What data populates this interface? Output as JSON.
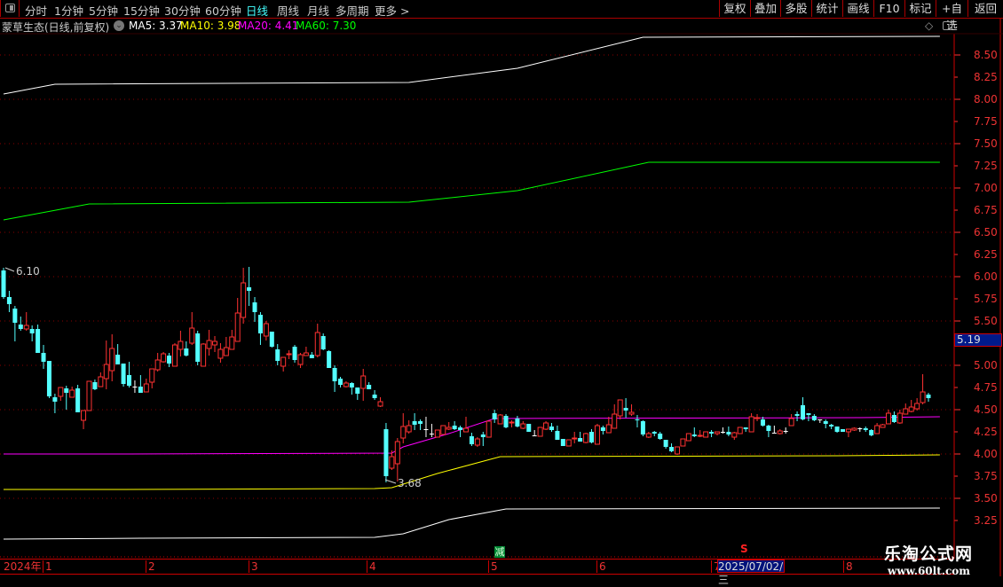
{
  "toolbar": {
    "tabs": [
      "分时",
      "1分钟",
      "5分钟",
      "15分钟",
      "30分钟",
      "60分钟",
      "日线",
      "周线",
      "月线",
      "多周期",
      "更多 >"
    ],
    "active_tab": "日线",
    "buttons": [
      "复权",
      "叠加",
      "多股",
      "统计",
      "画线",
      "F10",
      "标记",
      "+自选",
      "返回"
    ]
  },
  "info": {
    "title": "蒙草生态(日线,前复权)",
    "ma5": "MA5: 3.37",
    "ma10": "MA10: 3.98",
    "ma20": "MA20: 4.41",
    "ma60": "MA60: 7.30",
    "diamond": "◇"
  },
  "colors": {
    "up": "#ff3232",
    "down": "#54ffff",
    "flat": "#ffffff",
    "ma5": "#ffffff",
    "ma10": "#ffff00",
    "ma20": "#ff00ff",
    "ma60": "#00ff00",
    "axis": "#ff3333",
    "grid": "#8a0000"
  },
  "timeline": {
    "year": "2024年",
    "months": [
      "1",
      "2",
      "3",
      "4",
      "5",
      "6",
      "7",
      "8"
    ],
    "cursor_date": "2025/07/02/三"
  },
  "markers": {
    "jian": "减",
    "s": "S"
  },
  "price_tag": "5.19",
  "annotations": {
    "high": "6.10",
    "low": "3.68"
  },
  "watermark": {
    "name": "乐淘公式网",
    "url": "www.60lt.com"
  },
  "chart_data": {
    "type": "candlestick",
    "title": "蒙草生态(日线,前复权)",
    "ylim": [
      3.1,
      8.8
    ],
    "y_ticks": [
      "8.50",
      "8.25",
      "8.00",
      "7.75",
      "7.50",
      "7.25",
      "7.00",
      "6.75",
      "6.50",
      "6.25",
      "6.00",
      "5.75",
      "5.50",
      "5.25",
      "5.00",
      "4.75",
      "4.50",
      "4.25",
      "4.00",
      "3.75",
      "3.50",
      "3.25"
    ],
    "candles_ohlc": [
      [
        6.07,
        6.1,
        5.75,
        5.77
      ],
      [
        5.77,
        5.84,
        5.6,
        5.69
      ],
      [
        5.64,
        5.67,
        5.27,
        5.48
      ],
      [
        5.46,
        5.55,
        5.39,
        5.41
      ],
      [
        5.41,
        5.6,
        5.39,
        5.45
      ],
      [
        5.41,
        5.45,
        5.27,
        5.36
      ],
      [
        5.41,
        5.46,
        5.14,
        5.14
      ],
      [
        5.14,
        5.23,
        4.96,
        5.04
      ],
      [
        5.05,
        5.05,
        4.63,
        4.65
      ],
      [
        4.64,
        4.68,
        4.46,
        4.59
      ],
      [
        4.65,
        4.75,
        4.6,
        4.75
      ],
      [
        4.74,
        4.77,
        4.5,
        4.69
      ],
      [
        4.64,
        4.76,
        4.64,
        4.72
      ],
      [
        4.74,
        4.78,
        4.47,
        4.47
      ],
      [
        4.38,
        4.49,
        4.28,
        4.49
      ],
      [
        4.49,
        4.82,
        4.49,
        4.82
      ],
      [
        4.81,
        4.84,
        4.72,
        4.73
      ],
      [
        4.76,
        4.92,
        4.76,
        4.87
      ],
      [
        4.85,
        5.28,
        4.73,
        5.01
      ],
      [
        4.94,
        5.35,
        4.82,
        5.19
      ],
      [
        5.12,
        5.24,
        5.01,
        5.01
      ],
      [
        5.02,
        5.02,
        4.76,
        4.79
      ],
      [
        4.89,
        5.04,
        4.75,
        4.77
      ],
      [
        4.76,
        4.83,
        4.69,
        4.76
      ],
      [
        4.76,
        4.89,
        4.69,
        4.69
      ],
      [
        4.7,
        4.85,
        4.7,
        4.79
      ],
      [
        4.81,
        4.96,
        4.74,
        4.96
      ],
      [
        4.95,
        5.14,
        4.93,
        5.06
      ],
      [
        5.04,
        5.15,
        5.03,
        5.13
      ],
      [
        5.11,
        5.14,
        4.98,
        5.02
      ],
      [
        4.99,
        5.25,
        4.99,
        5.23
      ],
      [
        5.18,
        5.39,
        5.1,
        5.27
      ],
      [
        5.19,
        5.27,
        5.1,
        5.11
      ],
      [
        5.25,
        5.6,
        5.23,
        5.42
      ],
      [
        5.36,
        5.39,
        5.0,
        5.04
      ],
      [
        4.99,
        5.25,
        4.99,
        5.24
      ],
      [
        5.19,
        5.4,
        5.11,
        5.28
      ],
      [
        5.23,
        5.33,
        5.15,
        5.27
      ],
      [
        5.08,
        5.25,
        5.03,
        5.18
      ],
      [
        5.11,
        5.32,
        5.11,
        5.2
      ],
      [
        5.18,
        5.4,
        5.18,
        5.32
      ],
      [
        5.27,
        5.76,
        5.27,
        5.59
      ],
      [
        5.54,
        6.1,
        5.47,
        5.93
      ],
      [
        5.88,
        6.11,
        5.67,
        5.84
      ],
      [
        5.71,
        5.77,
        5.49,
        5.6
      ],
      [
        5.57,
        5.6,
        5.23,
        5.36
      ],
      [
        5.33,
        5.5,
        5.28,
        5.47
      ],
      [
        5.38,
        5.38,
        5.2,
        5.21
      ],
      [
        5.18,
        5.24,
        5.0,
        5.05
      ],
      [
        4.99,
        5.09,
        4.93,
        5.09
      ],
      [
        5.12,
        5.17,
        5.07,
        5.13
      ],
      [
        5.21,
        5.23,
        5.03,
        5.06
      ],
      [
        5.01,
        5.14,
        4.97,
        5.12
      ],
      [
        5.11,
        5.21,
        5.11,
        5.14
      ],
      [
        5.12,
        5.15,
        5.08,
        5.08
      ],
      [
        5.11,
        5.47,
        5.09,
        5.37
      ],
      [
        5.33,
        5.36,
        5.17,
        5.18
      ],
      [
        5.16,
        5.17,
        4.97,
        4.97
      ],
      [
        4.97,
        5.0,
        4.7,
        4.82
      ],
      [
        4.85,
        4.87,
        4.75,
        4.78
      ],
      [
        4.76,
        4.82,
        4.75,
        4.8
      ],
      [
        4.8,
        4.81,
        4.67,
        4.75
      ],
      [
        4.75,
        4.75,
        4.61,
        4.68
      ],
      [
        4.74,
        4.96,
        4.6,
        4.88
      ],
      [
        4.78,
        4.81,
        4.73,
        4.73
      ],
      [
        4.67,
        4.72,
        4.61,
        4.63
      ],
      [
        4.54,
        4.64,
        4.53,
        4.59
      ],
      [
        4.28,
        4.35,
        3.68,
        3.75
      ],
      [
        3.84,
        4.04,
        3.82,
        3.97
      ],
      [
        3.89,
        4.18,
        3.69,
        4.14
      ],
      [
        4.18,
        4.46,
        4.12,
        4.31
      ],
      [
        4.25,
        4.38,
        4.23,
        4.32
      ],
      [
        4.37,
        4.46,
        4.27,
        4.33
      ],
      [
        4.37,
        4.39,
        4.27,
        4.34
      ],
      [
        4.28,
        4.42,
        4.19,
        4.28
      ],
      [
        4.23,
        4.34,
        4.19,
        4.23
      ],
      [
        4.19,
        4.27,
        4.19,
        4.27
      ],
      [
        4.22,
        4.32,
        4.22,
        4.32
      ],
      [
        4.28,
        4.36,
        4.27,
        4.3
      ],
      [
        4.32,
        4.37,
        4.27,
        4.28
      ],
      [
        4.3,
        4.32,
        4.19,
        4.27
      ],
      [
        4.25,
        4.42,
        4.25,
        4.29
      ],
      [
        4.2,
        4.24,
        4.09,
        4.11
      ],
      [
        4.1,
        4.19,
        4.08,
        4.17
      ],
      [
        4.22,
        4.25,
        4.09,
        4.19
      ],
      [
        4.19,
        4.37,
        4.19,
        4.37
      ],
      [
        4.46,
        4.5,
        4.35,
        4.39
      ],
      [
        4.34,
        4.45,
        4.34,
        4.44
      ],
      [
        4.43,
        4.45,
        4.29,
        4.3
      ],
      [
        4.35,
        4.38,
        4.3,
        4.36
      ],
      [
        4.4,
        4.43,
        4.3,
        4.31
      ],
      [
        4.29,
        4.37,
        4.28,
        4.34
      ],
      [
        4.34,
        4.34,
        4.25,
        4.25
      ],
      [
        4.21,
        4.27,
        4.2,
        4.21
      ],
      [
        4.2,
        4.3,
        4.2,
        4.3
      ],
      [
        4.28,
        4.37,
        4.27,
        4.35
      ],
      [
        4.31,
        4.35,
        4.25,
        4.27
      ],
      [
        4.26,
        4.32,
        4.16,
        4.16
      ],
      [
        4.17,
        4.17,
        4.09,
        4.09
      ],
      [
        4.09,
        4.16,
        4.09,
        4.16
      ],
      [
        4.17,
        4.25,
        4.12,
        4.18
      ],
      [
        4.18,
        4.25,
        4.14,
        4.14
      ],
      [
        4.13,
        4.24,
        4.12,
        4.23
      ],
      [
        4.25,
        4.28,
        4.12,
        4.13
      ],
      [
        4.11,
        4.34,
        4.11,
        4.32
      ],
      [
        4.3,
        4.32,
        4.22,
        4.26
      ],
      [
        4.24,
        4.42,
        4.24,
        4.33
      ],
      [
        4.29,
        4.56,
        4.29,
        4.45
      ],
      [
        4.43,
        4.61,
        4.39,
        4.61
      ],
      [
        4.52,
        4.63,
        4.41,
        4.49
      ],
      [
        4.45,
        4.56,
        4.43,
        4.47
      ],
      [
        4.39,
        4.44,
        4.3,
        4.38
      ],
      [
        4.37,
        4.38,
        4.2,
        4.22
      ],
      [
        4.19,
        4.25,
        4.18,
        4.23
      ],
      [
        4.25,
        4.26,
        4.2,
        4.23
      ],
      [
        4.23,
        4.25,
        4.16,
        4.17
      ],
      [
        4.16,
        4.16,
        4.06,
        4.08
      ],
      [
        4.08,
        4.12,
        4.02,
        4.03
      ],
      [
        4.0,
        4.08,
        3.99,
        4.08
      ],
      [
        4.09,
        4.17,
        4.09,
        4.17
      ],
      [
        4.15,
        4.23,
        4.15,
        4.23
      ],
      [
        4.22,
        4.3,
        4.19,
        4.2
      ],
      [
        4.2,
        4.27,
        4.19,
        4.21
      ],
      [
        4.19,
        4.25,
        4.19,
        4.25
      ],
      [
        4.25,
        4.27,
        4.19,
        4.23
      ],
      [
        4.23,
        4.25,
        4.21,
        4.25
      ],
      [
        4.25,
        4.3,
        4.23,
        4.25
      ],
      [
        4.25,
        4.31,
        4.2,
        4.22
      ],
      [
        4.19,
        4.25,
        4.16,
        4.24
      ],
      [
        4.23,
        4.3,
        4.23,
        4.3
      ],
      [
        4.3,
        4.3,
        4.25,
        4.28
      ],
      [
        4.25,
        4.46,
        4.25,
        4.42
      ],
      [
        4.4,
        4.45,
        4.37,
        4.41
      ],
      [
        4.39,
        4.42,
        4.31,
        4.32
      ],
      [
        4.32,
        4.33,
        4.19,
        4.26
      ],
      [
        4.24,
        4.32,
        4.23,
        4.24
      ],
      [
        4.23,
        4.28,
        4.22,
        4.26
      ],
      [
        4.26,
        4.3,
        4.23,
        4.26
      ],
      [
        4.32,
        4.45,
        4.32,
        4.4
      ],
      [
        4.45,
        4.48,
        4.37,
        4.43
      ],
      [
        4.55,
        4.64,
        4.38,
        4.39
      ],
      [
        4.46,
        4.46,
        4.37,
        4.44
      ],
      [
        4.43,
        4.45,
        4.37,
        4.38
      ],
      [
        4.39,
        4.39,
        4.35,
        4.39
      ],
      [
        4.37,
        4.39,
        4.29,
        4.34
      ],
      [
        4.33,
        4.34,
        4.28,
        4.31
      ],
      [
        4.31,
        4.31,
        4.24,
        4.25
      ],
      [
        4.28,
        4.28,
        4.25,
        4.25
      ],
      [
        4.25,
        4.28,
        4.19,
        4.28
      ],
      [
        4.27,
        4.3,
        4.26,
        4.29
      ],
      [
        4.29,
        4.3,
        4.25,
        4.29
      ],
      [
        4.29,
        4.31,
        4.25,
        4.27
      ],
      [
        4.27,
        4.28,
        4.2,
        4.21
      ],
      [
        4.23,
        4.35,
        4.23,
        4.32
      ],
      [
        4.3,
        4.34,
        4.3,
        4.33
      ],
      [
        4.34,
        4.5,
        4.34,
        4.46
      ],
      [
        4.44,
        4.48,
        4.35,
        4.36
      ],
      [
        4.35,
        4.5,
        4.34,
        4.46
      ],
      [
        4.45,
        4.57,
        4.45,
        4.51
      ],
      [
        4.48,
        4.61,
        4.47,
        4.53
      ],
      [
        4.51,
        4.63,
        4.49,
        4.57
      ],
      [
        4.58,
        4.9,
        4.56,
        4.7
      ],
      [
        4.67,
        4.69,
        4.59,
        4.63
      ]
    ],
    "series": [
      {
        "name": "MA5 band (white upper)",
        "color_key": "ma5",
        "points": [
          [
            0,
            8.06
          ],
          [
            9,
            8.17
          ],
          [
            71,
            8.19
          ],
          [
            90,
            8.35
          ],
          [
            112,
            8.7
          ],
          [
            164,
            8.71
          ]
        ]
      },
      {
        "name": "MA60",
        "color_key": "ma60",
        "points": [
          [
            0,
            6.64
          ],
          [
            15,
            6.82
          ],
          [
            71,
            6.84
          ],
          [
            90,
            6.97
          ],
          [
            113,
            7.29
          ],
          [
            164,
            7.29
          ]
        ]
      },
      {
        "name": "MA20",
        "color_key": "ma20",
        "points": [
          [
            0,
            4.0
          ],
          [
            22,
            4.0
          ],
          [
            68,
            4.01
          ],
          [
            70,
            4.08
          ],
          [
            78,
            4.23
          ],
          [
            86,
            4.4
          ],
          [
            150,
            4.41
          ],
          [
            164,
            4.42
          ]
        ]
      },
      {
        "name": "MA10",
        "color_key": "ma10",
        "points": [
          [
            0,
            3.6
          ],
          [
            21,
            3.6
          ],
          [
            65,
            3.61
          ],
          [
            68,
            3.62
          ],
          [
            76,
            3.78
          ],
          [
            87,
            3.97
          ],
          [
            146,
            3.98
          ],
          [
            164,
            3.99
          ]
        ]
      },
      {
        "name": "MA5 band (white lower)",
        "color_key": "ma5",
        "points": [
          [
            0,
            3.04
          ],
          [
            24,
            3.05
          ],
          [
            65,
            3.06
          ],
          [
            70,
            3.1
          ],
          [
            78,
            3.26
          ],
          [
            88,
            3.38
          ],
          [
            164,
            3.39
          ]
        ]
      }
    ]
  }
}
